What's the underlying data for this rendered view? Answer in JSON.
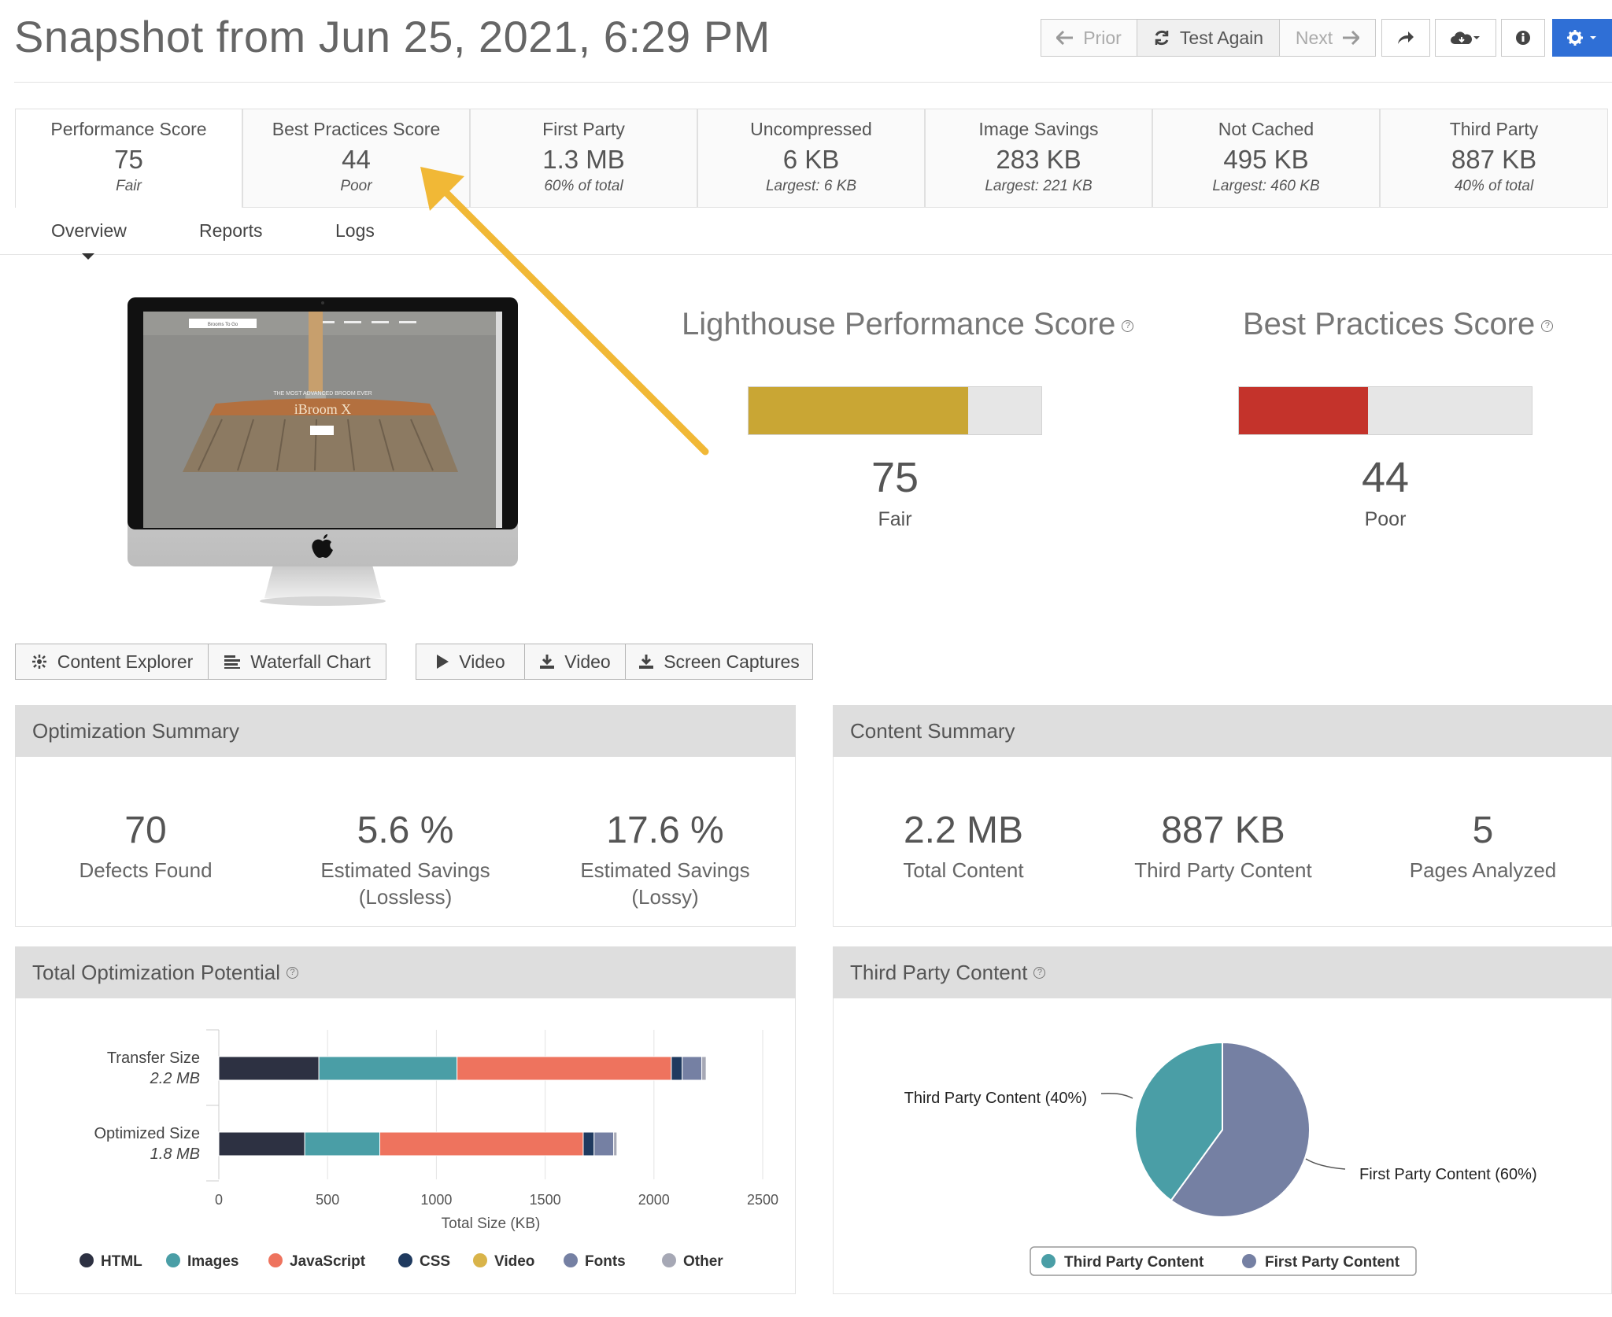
{
  "header": {
    "title": "Snapshot from Jun 25, 2021, 6:29 PM",
    "buttons": {
      "prior": "Prior",
      "test_again": "Test Again",
      "next": "Next"
    }
  },
  "kpis": [
    {
      "label": "Performance Score",
      "value": "75",
      "sub": "Fair"
    },
    {
      "label": "Best Practices Score",
      "value": "44",
      "sub": "Poor"
    },
    {
      "label": "First Party",
      "value": "1.3 MB",
      "sub": "60% of total"
    },
    {
      "label": "Uncompressed",
      "value": "6 KB",
      "sub": "Largest: 6 KB"
    },
    {
      "label": "Image Savings",
      "value": "283 KB",
      "sub": "Largest: 221 KB"
    },
    {
      "label": "Not Cached",
      "value": "495 KB",
      "sub": "Largest: 460 KB"
    },
    {
      "label": "Third Party",
      "value": "887 KB",
      "sub": "40% of total"
    }
  ],
  "tabs": [
    "Overview",
    "Reports",
    "Logs"
  ],
  "preview": {
    "site_name": "Brooms To Go",
    "tagline": "THE MOST ADVANCED BROOM EVER",
    "product": "iBroom X"
  },
  "gauges": {
    "performance": {
      "title": "Lighthouse Performance Score",
      "help": "?",
      "value": "75",
      "rating": "Fair",
      "fraction": 0.75,
      "color": "#c9a634"
    },
    "best_practices": {
      "title": "Best Practices Score",
      "help": "?",
      "value": "44",
      "rating": "Poor",
      "fraction": 0.44,
      "color": "#c4332b"
    }
  },
  "actions": {
    "content_explorer": "Content Explorer",
    "waterfall_chart": "Waterfall Chart",
    "play_video": "Video",
    "download_video": "Video",
    "screen_captures": "Screen Captures"
  },
  "optimization_summary": {
    "title": "Optimization Summary",
    "metrics": [
      {
        "value": "70",
        "label": "Defects Found",
        "label2": ""
      },
      {
        "value": "5.6 %",
        "label": "Estimated Savings",
        "label2": "(Lossless)"
      },
      {
        "value": "17.6 %",
        "label": "Estimated Savings",
        "label2": "(Lossy)"
      }
    ]
  },
  "content_summary": {
    "title": "Content Summary",
    "metrics": [
      {
        "value": "2.2 MB",
        "label": "Total Content"
      },
      {
        "value": "887 KB",
        "label": "Third Party Content"
      },
      {
        "value": "5",
        "label": "Pages Analyzed"
      }
    ]
  },
  "optimization_potential": {
    "title": "Total Optimization Potential",
    "help": "?"
  },
  "third_party_panel": {
    "title": "Third Party Content",
    "help": "?"
  },
  "chart_data": [
    {
      "type": "bar",
      "orientation": "horizontal",
      "stacked": true,
      "categories": [
        "Transfer Size",
        "Optimized Size"
      ],
      "category_sublabels": [
        "2.2 MB",
        "1.8 MB"
      ],
      "series": [
        {
          "name": "HTML",
          "color": "#2d3142",
          "values": [
            460,
            395
          ]
        },
        {
          "name": "Images",
          "color": "#4a9ea6",
          "values": [
            635,
            345
          ]
        },
        {
          "name": "JavaScript",
          "color": "#ee735e",
          "values": [
            985,
            935
          ]
        },
        {
          "name": "CSS",
          "color": "#1f3a5f",
          "values": [
            50,
            50
          ]
        },
        {
          "name": "Video",
          "color": "#d9b44a",
          "values": [
            0,
            0
          ]
        },
        {
          "name": "Fonts",
          "color": "#7580a3",
          "values": [
            90,
            90
          ]
        },
        {
          "name": "Other",
          "color": "#a6a8b5",
          "values": [
            20,
            15
          ]
        }
      ],
      "xlabel": "Total Size (KB)",
      "xlim": [
        0,
        2500
      ],
      "xticks": [
        0,
        500,
        1000,
        1500,
        2000,
        2500
      ],
      "grid": true,
      "legend": "bottom"
    },
    {
      "type": "pie",
      "slices": [
        {
          "name": "Third Party Content",
          "label": "Third Party Content (40%)",
          "value": 40,
          "color": "#4a9ea6"
        },
        {
          "name": "First Party Content",
          "label": "First Party Content (60%)",
          "value": 60,
          "color": "#7580a3"
        }
      ],
      "legend": "bottom"
    }
  ]
}
